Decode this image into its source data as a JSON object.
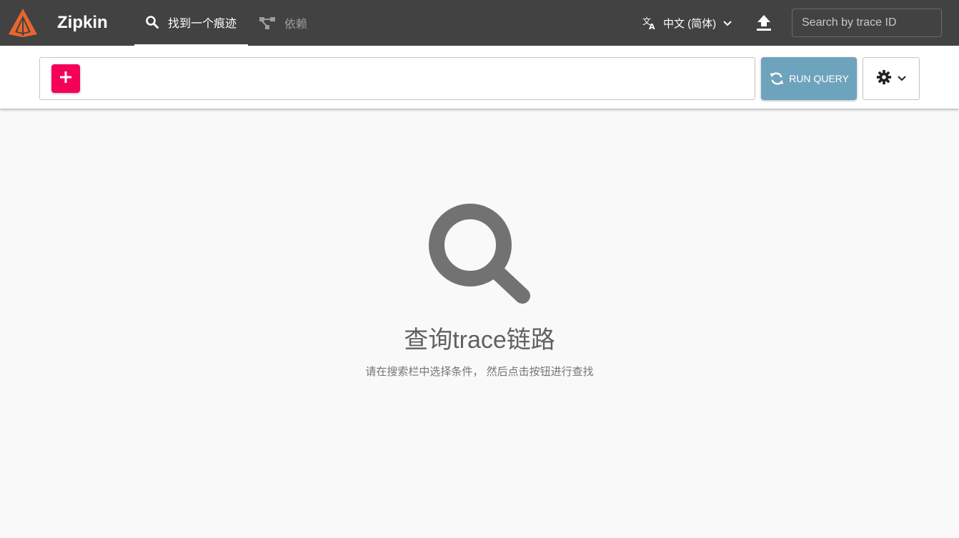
{
  "header": {
    "brand": "Zipkin",
    "tabs": [
      {
        "label": "找到一个痕迹",
        "icon": "search-icon",
        "active": true
      },
      {
        "label": "依赖",
        "icon": "dependency-graph-icon",
        "active": false
      }
    ],
    "language": {
      "label": "中文 (简体)",
      "icon": "translate-icon"
    },
    "upload_icon": "upload-icon",
    "trace_search": {
      "placeholder": "Search by trace ID",
      "value": ""
    }
  },
  "query_bar": {
    "add_icon": "plus-icon",
    "run_query_label": "RUN QUERY",
    "settings_icon": "gear-icon"
  },
  "empty_state": {
    "icon": "search-icon",
    "title": "查询trace链路",
    "description": "请在搜索栏中选择条件， 然后点击按钮进行查找"
  },
  "colors": {
    "header_bg": "#424242",
    "add_button": "#f50057",
    "run_query_button": "#6ea3bd",
    "logo_orange": "#e8662e",
    "page_bg": "#f9f9f9"
  }
}
